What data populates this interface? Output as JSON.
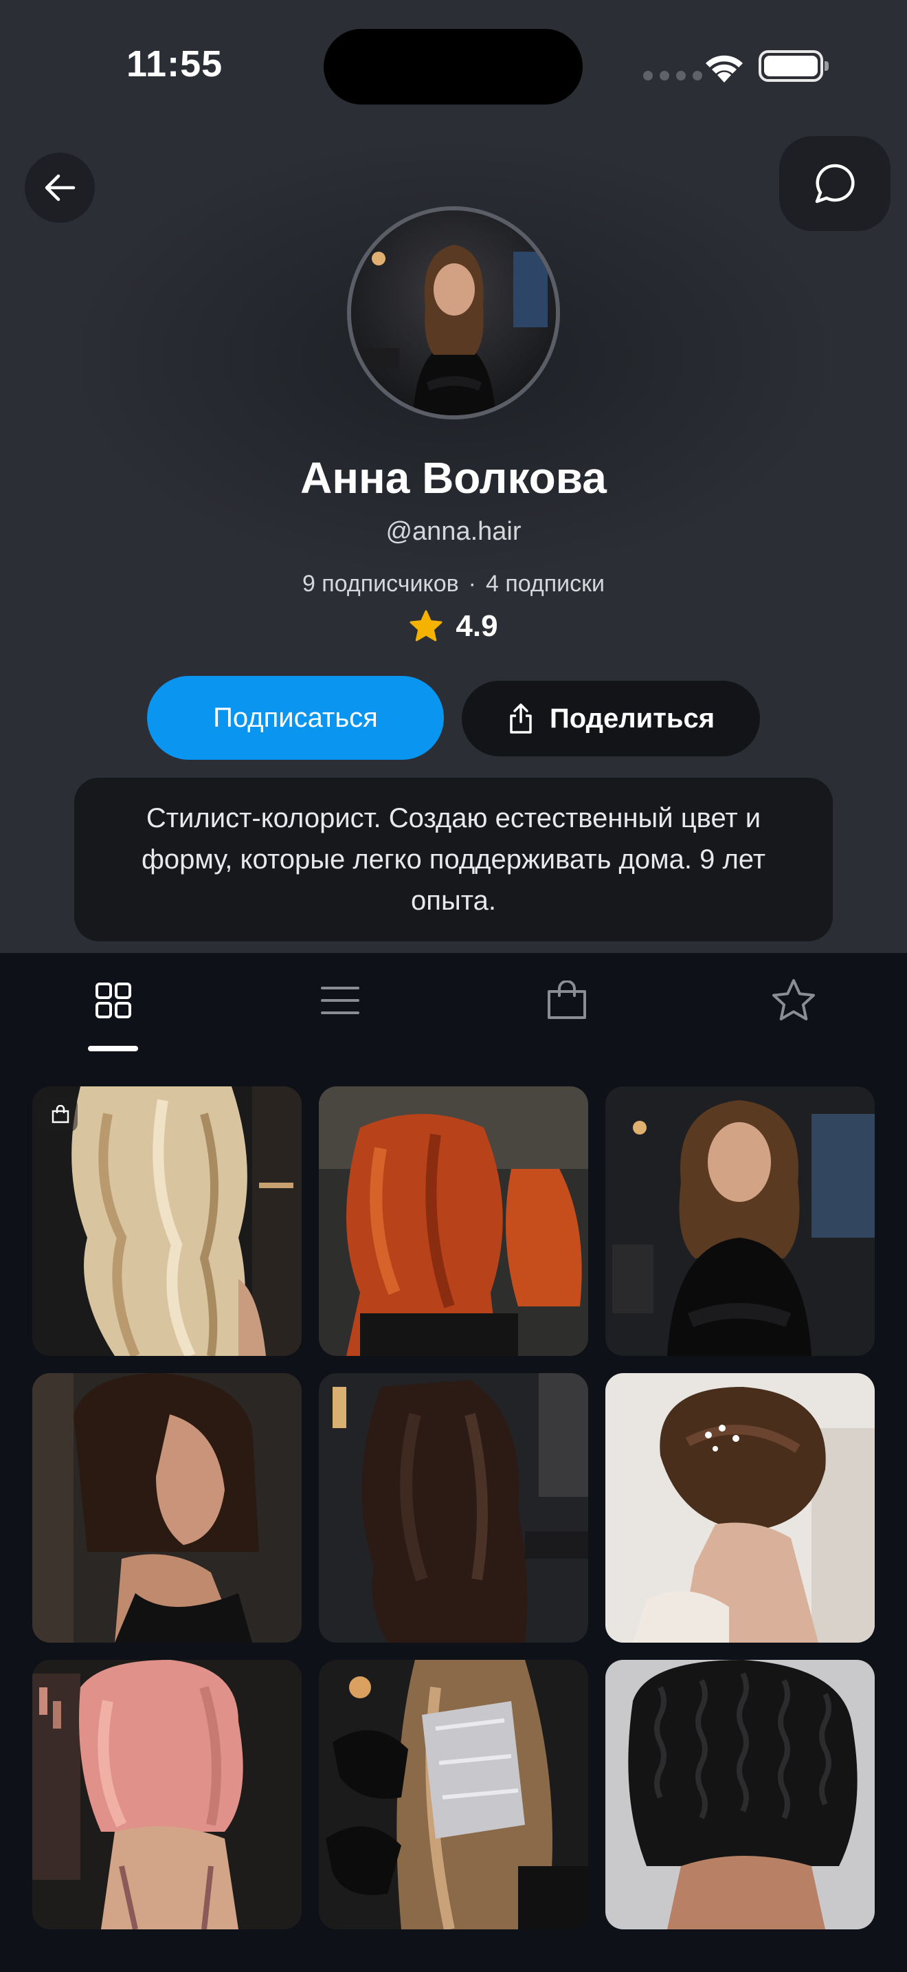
{
  "status_bar": {
    "time": "11:55"
  },
  "profile": {
    "name": "Анна Волкова",
    "handle": "@anna.hair",
    "followers": "9 подписчиков",
    "separator": "·",
    "following": "4 подписки",
    "rating": "4.9",
    "bio": "Стилист-колорист. Создаю естественный цвет и форму, которые легко поддерживать дома. 9 лет опыта."
  },
  "actions": {
    "follow_label": "Подписаться",
    "share_label": "Поделиться"
  },
  "tabs": [
    {
      "icon": "grid-icon",
      "active": true
    },
    {
      "icon": "list-icon",
      "active": false
    },
    {
      "icon": "shopping-bag-icon",
      "active": false
    },
    {
      "icon": "star-icon",
      "active": false
    }
  ],
  "posts": [
    {
      "subject": "blonde-waves",
      "has_product": true
    },
    {
      "subject": "copper-waves",
      "has_product": false
    },
    {
      "subject": "stylist-portrait",
      "has_product": false
    },
    {
      "subject": "brunette-bob",
      "has_product": false
    },
    {
      "subject": "dark-brown-waves",
      "has_product": false
    },
    {
      "subject": "bridal-updo",
      "has_product": false
    },
    {
      "subject": "pink-waves",
      "has_product": false
    },
    {
      "subject": "foil-highlights",
      "has_product": false
    },
    {
      "subject": "black-curls",
      "has_product": false
    }
  ],
  "colors": {
    "accent": "#0a95f0",
    "header_bg": "#2b2e34",
    "page_bg": "#0e1117",
    "star": "#f5b300"
  }
}
